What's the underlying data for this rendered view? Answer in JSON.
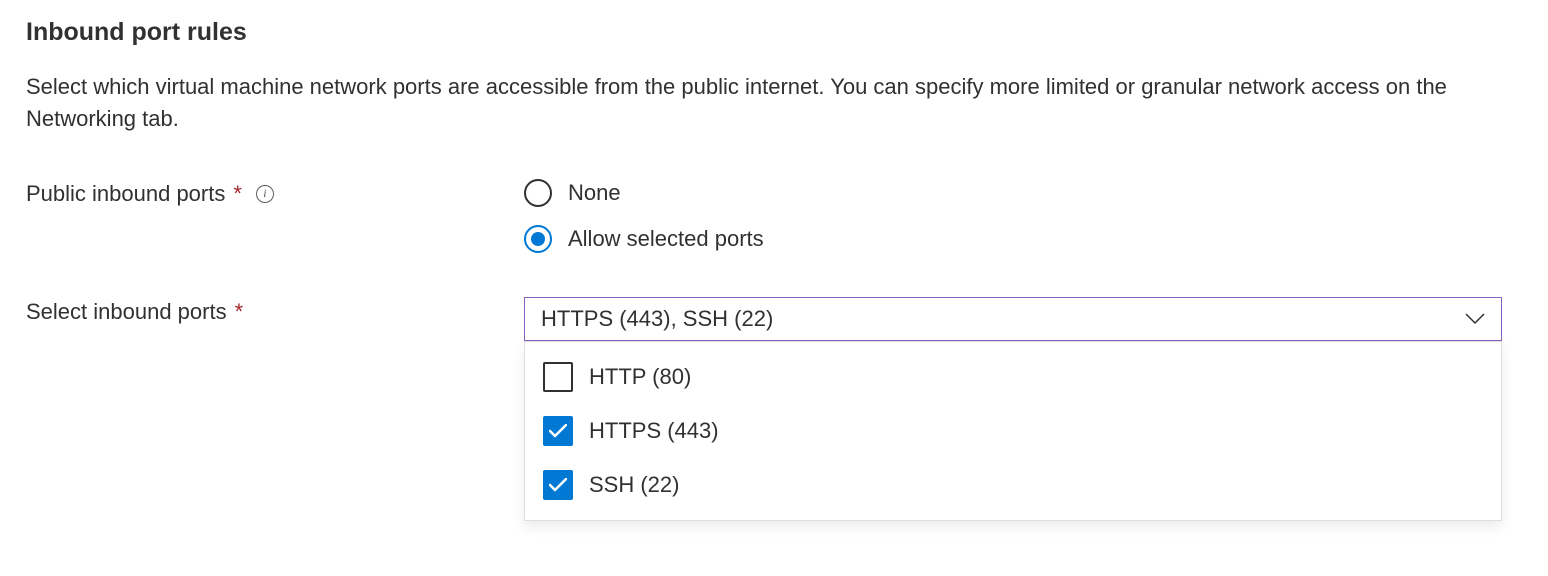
{
  "section": {
    "title": "Inbound port rules",
    "description": "Select which virtual machine network ports are accessible from the public internet. You can specify more limited or granular network access on the Networking tab."
  },
  "publicInboundPorts": {
    "label": "Public inbound ports",
    "required": true,
    "options": [
      {
        "label": "None",
        "selected": false
      },
      {
        "label": "Allow selected ports",
        "selected": true
      }
    ]
  },
  "selectInboundPorts": {
    "label": "Select inbound ports",
    "required": true,
    "selectedText": "HTTPS (443), SSH (22)",
    "options": [
      {
        "label": "HTTP (80)",
        "checked": false
      },
      {
        "label": "HTTPS (443)",
        "checked": true
      },
      {
        "label": "SSH (22)",
        "checked": true
      }
    ]
  }
}
